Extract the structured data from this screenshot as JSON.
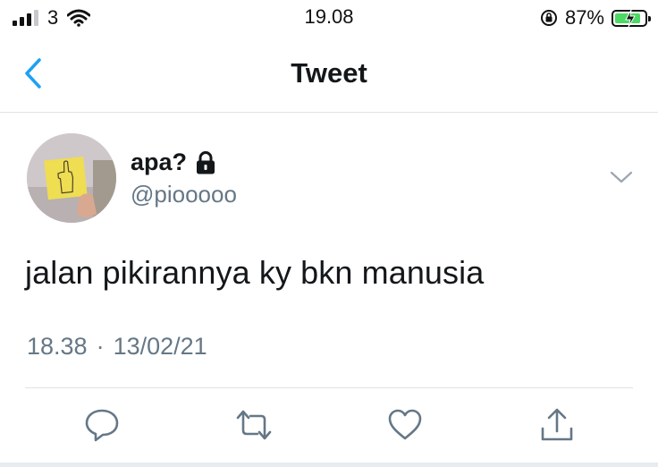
{
  "status_bar": {
    "carrier": "3",
    "time": "19.08",
    "battery_percent": "87%",
    "battery_level": 0.87,
    "battery_color": "#4cd964"
  },
  "nav": {
    "title": "Tweet",
    "back_icon": "chevron-left-icon",
    "accent_color": "#1da1f2"
  },
  "tweet": {
    "display_name": "apa?",
    "protected_icon": "lock-icon",
    "username": "@piooooo",
    "text": "jalan pikirannya ky bkn manusia",
    "time": "18.38",
    "separator": "·",
    "date": "13/02/21"
  },
  "actions": {
    "reply_icon": "reply-icon",
    "retweet_icon": "retweet-icon",
    "like_icon": "heart-icon",
    "share_icon": "share-icon",
    "icon_color": "#657786"
  }
}
